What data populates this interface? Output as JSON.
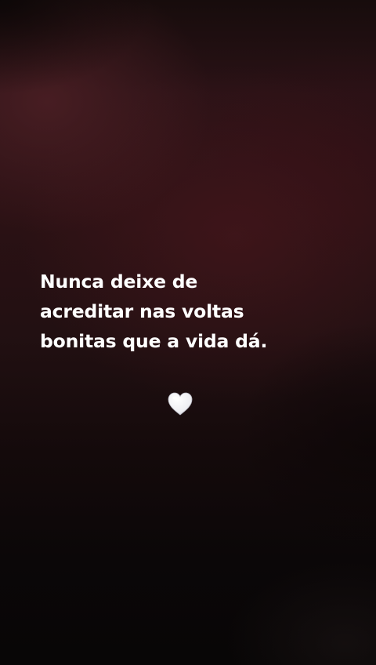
{
  "story": {
    "quote_lines": [
      "Nunca deixe de",
      "acreditar nas voltas",
      "bonitas que a vida dá."
    ],
    "sticker": {
      "icon": "white-heart-icon",
      "color": "#f2f2f4"
    }
  },
  "colors": {
    "background_dark": "#080606",
    "background_red": "#2b1114",
    "text": "#ffffff"
  }
}
